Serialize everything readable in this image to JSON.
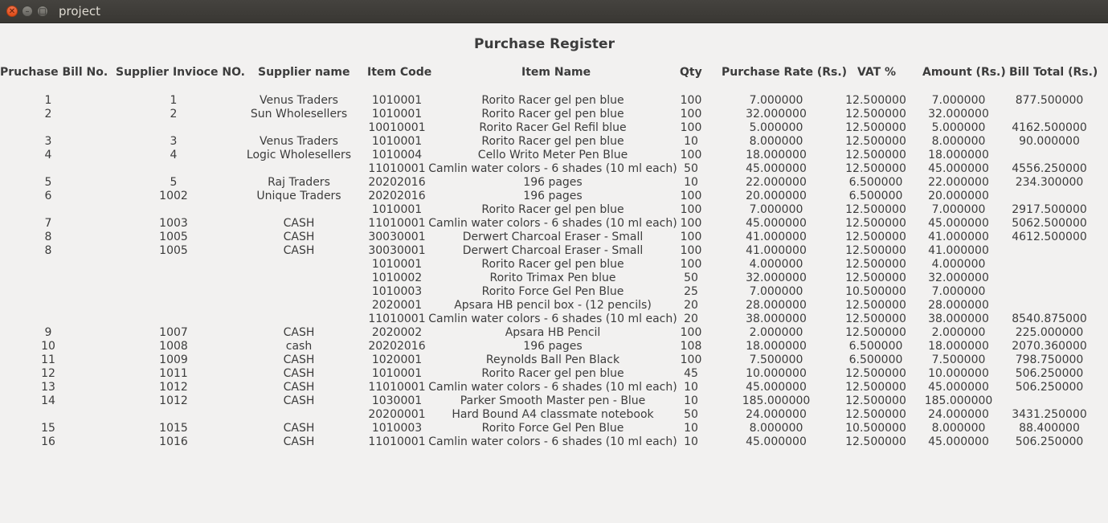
{
  "window": {
    "title": "project",
    "close_glyph": "✕",
    "minimize_glyph": "–",
    "maximize_glyph": "□"
  },
  "heading": "Purchase Register",
  "columns": [
    "Pruchase Bill No.",
    "Supplier Invioce NO.",
    "Supplier name",
    "Item Code",
    "Item Name",
    "Qty",
    "Purchase Rate (Rs.)",
    "VAT %",
    "Amount (Rs.)",
    "Bill Total (Rs.)"
  ],
  "rows": [
    [
      "1",
      "1",
      "Venus Traders",
      "1010001",
      "Rorito Racer gel pen blue",
      "100",
      "7.000000",
      "12.500000",
      "7.000000",
      "877.500000"
    ],
    [
      "2",
      "2",
      "Sun Wholesellers",
      "1010001",
      "Rorito Racer gel pen blue",
      "100",
      "32.000000",
      "12.500000",
      "32.000000",
      ""
    ],
    [
      "",
      "",
      "",
      "10010001",
      "Rorito Racer Gel Refil blue",
      "100",
      "5.000000",
      "12.500000",
      "5.000000",
      "4162.500000"
    ],
    [
      "3",
      "3",
      "Venus Traders",
      "1010001",
      "Rorito Racer gel pen blue",
      "10",
      "8.000000",
      "12.500000",
      "8.000000",
      "90.000000"
    ],
    [
      "4",
      "4",
      "Logic Wholesellers",
      "1010004",
      "Cello Writo Meter Pen Blue",
      "100",
      "18.000000",
      "12.500000",
      "18.000000",
      ""
    ],
    [
      "",
      "",
      "",
      "11010001",
      "Camlin water colors - 6 shades (10 ml each)",
      "50",
      "45.000000",
      "12.500000",
      "45.000000",
      "4556.250000"
    ],
    [
      "5",
      "5",
      "Raj Traders",
      "20202016",
      "196 pages",
      "10",
      "22.000000",
      "6.500000",
      "22.000000",
      "234.300000"
    ],
    [
      "6",
      "1002",
      "Unique Traders",
      "20202016",
      "196 pages",
      "100",
      "20.000000",
      "6.500000",
      "20.000000",
      ""
    ],
    [
      "",
      "",
      "",
      "1010001",
      "Rorito Racer gel pen blue",
      "100",
      "7.000000",
      "12.500000",
      "7.000000",
      "2917.500000"
    ],
    [
      "7",
      "1003",
      "CASH",
      "11010001",
      "Camlin water colors - 6 shades (10 ml each)",
      "100",
      "45.000000",
      "12.500000",
      "45.000000",
      "5062.500000"
    ],
    [
      "8",
      "1005",
      "CASH",
      "30030001",
      "Derwert Charcoal Eraser - Small",
      "100",
      "41.000000",
      "12.500000",
      "41.000000",
      "4612.500000"
    ],
    [
      "8",
      "1005",
      "CASH",
      "30030001",
      "Derwert Charcoal Eraser - Small",
      "100",
      "41.000000",
      "12.500000",
      "41.000000",
      ""
    ],
    [
      "",
      "",
      "",
      "1010001",
      "Rorito Racer gel pen blue",
      "100",
      "4.000000",
      "12.500000",
      "4.000000",
      ""
    ],
    [
      "",
      "",
      "",
      "1010002",
      "Rorito Trimax Pen blue",
      "50",
      "32.000000",
      "12.500000",
      "32.000000",
      ""
    ],
    [
      "",
      "",
      "",
      "1010003",
      "Rorito Force Gel Pen Blue",
      "25",
      "7.000000",
      "10.500000",
      "7.000000",
      ""
    ],
    [
      "",
      "",
      "",
      "2020001",
      "Apsara HB pencil box - (12 pencils)",
      "20",
      "28.000000",
      "12.500000",
      "28.000000",
      ""
    ],
    [
      "",
      "",
      "",
      "11010001",
      "Camlin water colors - 6 shades (10 ml each)",
      "20",
      "38.000000",
      "12.500000",
      "38.000000",
      "8540.875000"
    ],
    [
      "9",
      "1007",
      "CASH",
      "2020002",
      "Apsara HB Pencil",
      "100",
      "2.000000",
      "12.500000",
      "2.000000",
      "225.000000"
    ],
    [
      "10",
      "1008",
      "cash",
      "20202016",
      "196 pages",
      "108",
      "18.000000",
      "6.500000",
      "18.000000",
      "2070.360000"
    ],
    [
      "11",
      "1009",
      "CASH",
      "1020001",
      "Reynolds Ball Pen Black",
      "100",
      "7.500000",
      "6.500000",
      "7.500000",
      "798.750000"
    ],
    [
      "12",
      "1011",
      "CASH",
      "1010001",
      "Rorito Racer gel pen blue",
      "45",
      "10.000000",
      "12.500000",
      "10.000000",
      "506.250000"
    ],
    [
      "13",
      "1012",
      "CASH",
      "11010001",
      "Camlin water colors - 6 shades (10 ml each)",
      "10",
      "45.000000",
      "12.500000",
      "45.000000",
      "506.250000"
    ],
    [
      "14",
      "1012",
      "CASH",
      "1030001",
      "Parker Smooth Master pen - Blue",
      "10",
      "185.000000",
      "12.500000",
      "185.000000",
      ""
    ],
    [
      "",
      "",
      "",
      "20200001",
      "Hard Bound A4 classmate notebook",
      "50",
      "24.000000",
      "12.500000",
      "24.000000",
      "3431.250000"
    ],
    [
      "15",
      "1015",
      "CASH",
      "1010003",
      "Rorito Force Gel Pen Blue",
      "10",
      "8.000000",
      "10.500000",
      "8.000000",
      "88.400000"
    ],
    [
      "16",
      "1016",
      "CASH",
      "11010001",
      "Camlin water colors - 6 shades (10 ml each)",
      "10",
      "45.000000",
      "12.500000",
      "45.000000",
      "506.250000"
    ]
  ]
}
